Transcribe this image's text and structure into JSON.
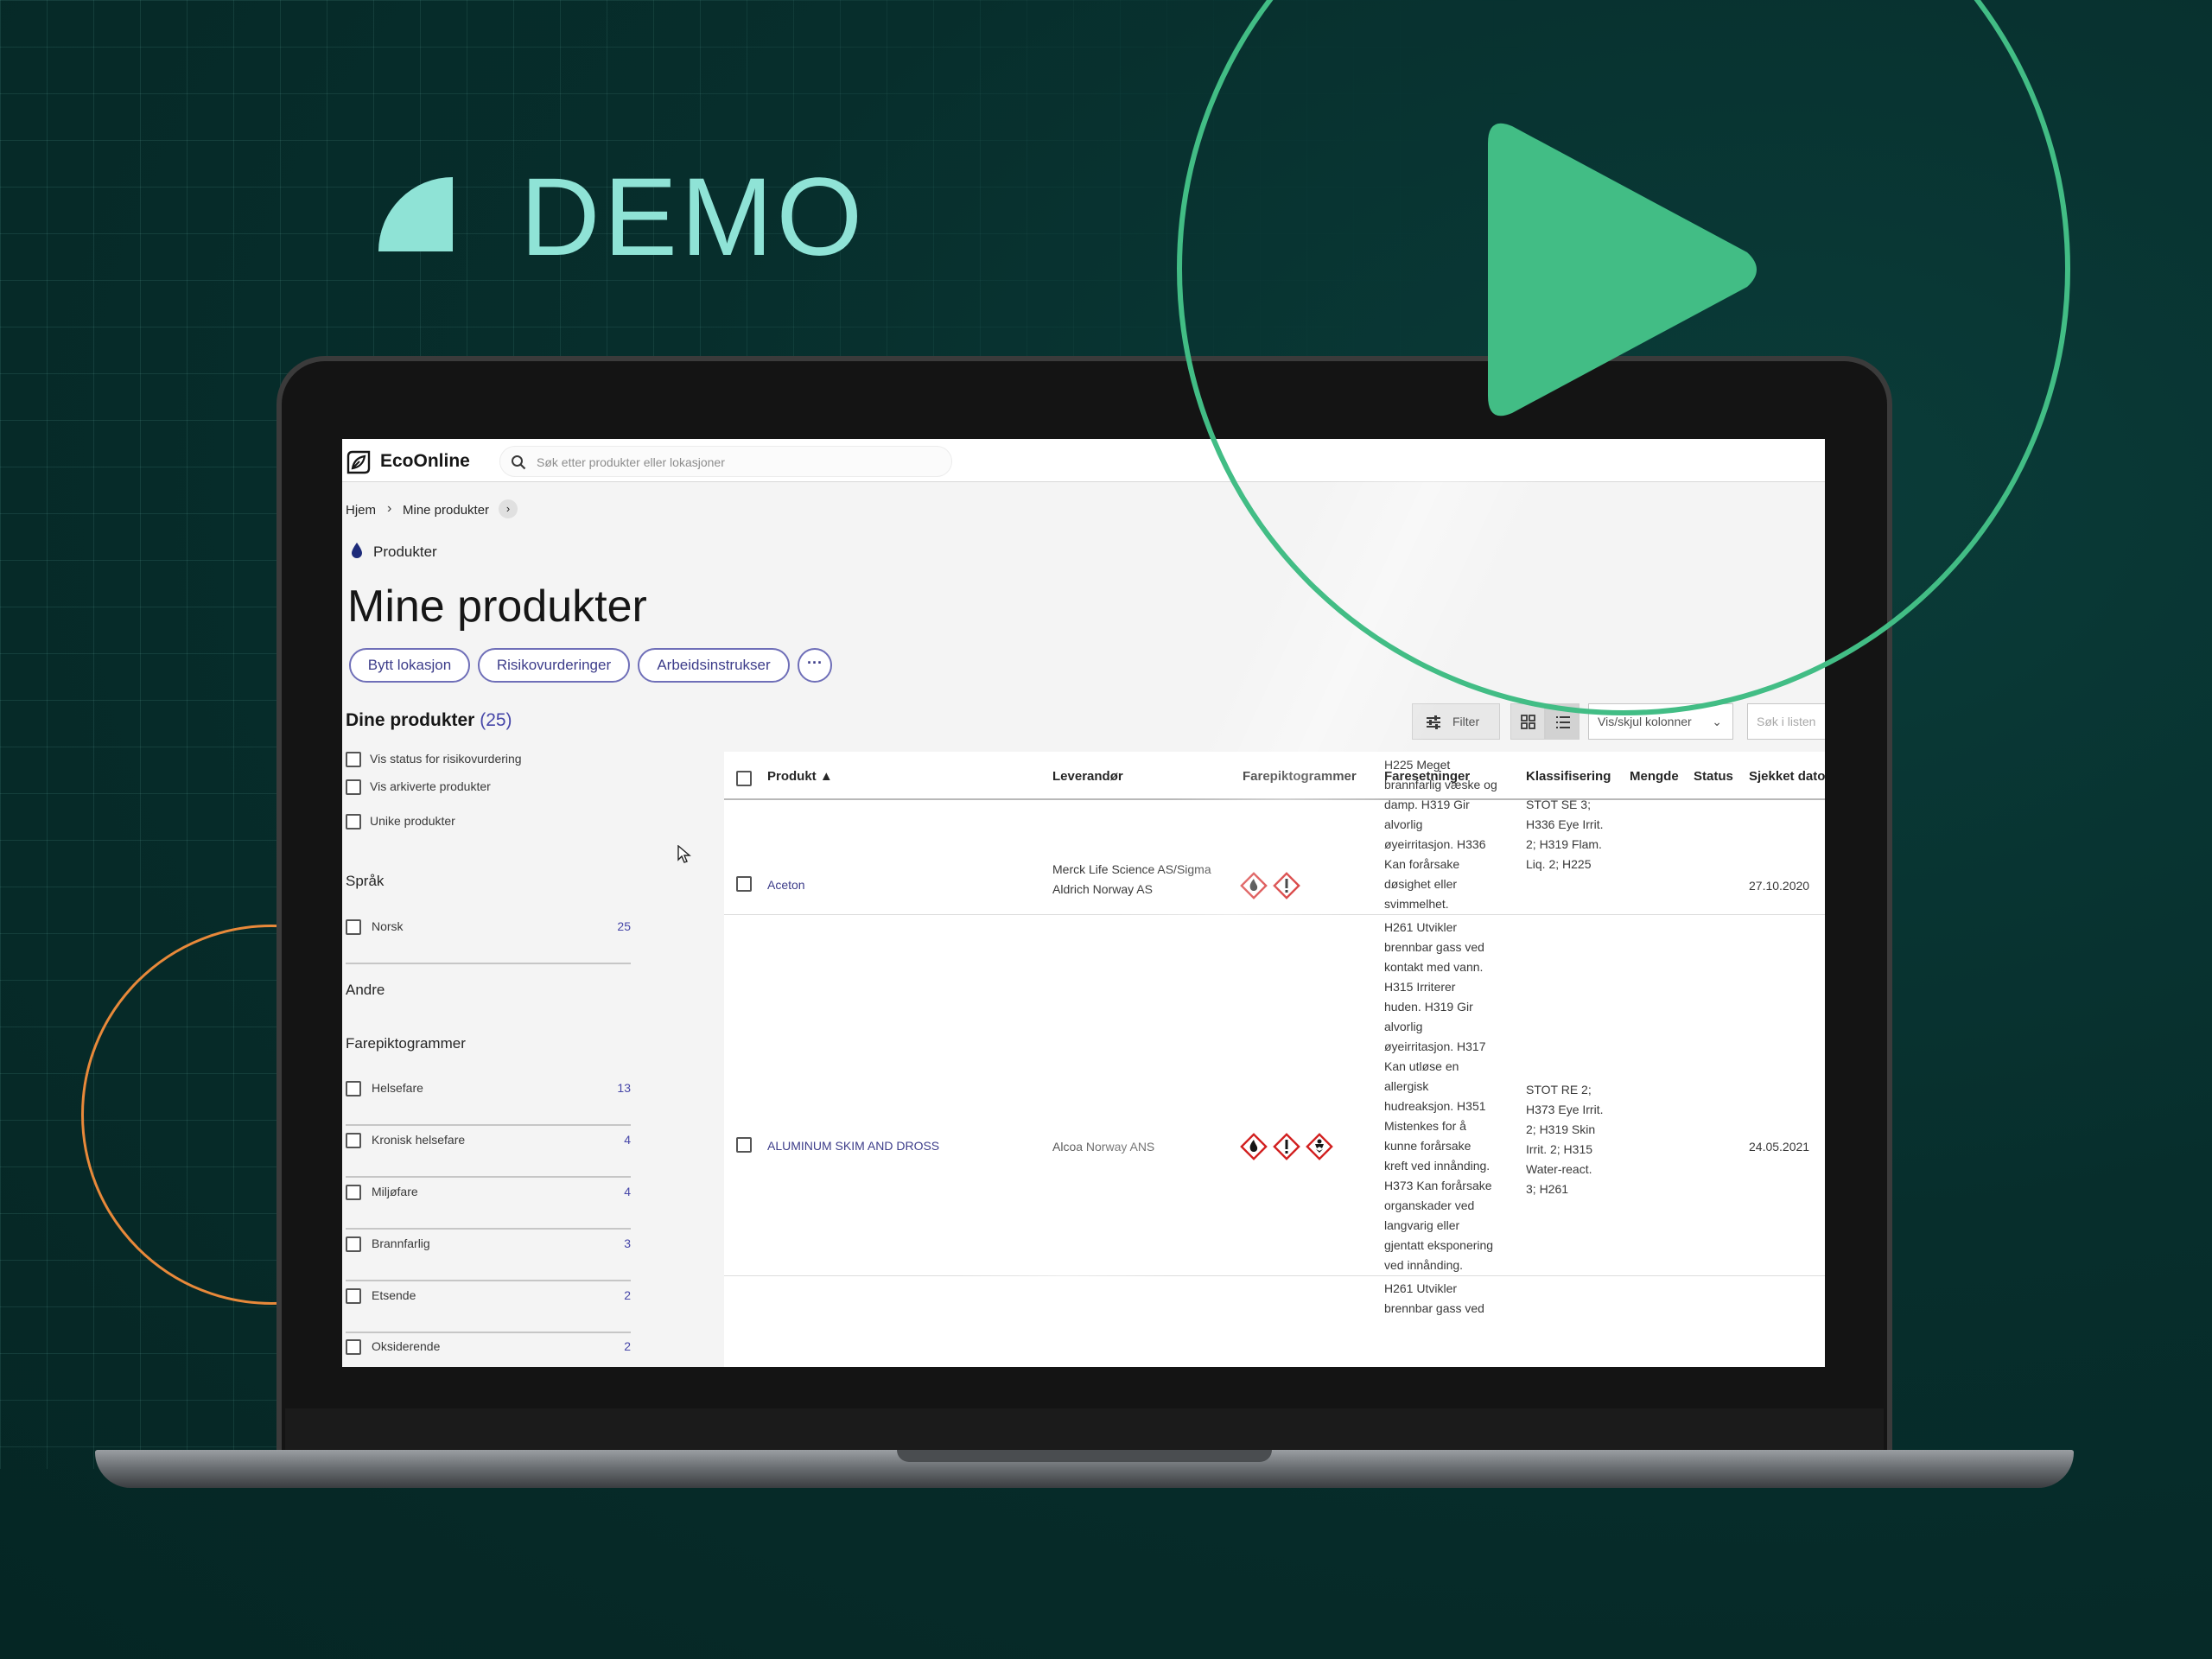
{
  "banner": {
    "label": "DEMO"
  },
  "app": {
    "brand": "EcoOnline",
    "search_placeholder": "Søk etter produkter eller lokasjoner"
  },
  "breadcrumb": {
    "home": "Hjem",
    "current": "Mine produkter"
  },
  "section": {
    "label": "Produkter"
  },
  "page": {
    "title": "Mine produkter"
  },
  "actions": {
    "switch_location": "Bytt lokasjon",
    "risk_assessments": "Risikovurderinger",
    "work_instructions": "Arbeidsinstrukser",
    "more": "···"
  },
  "sidebar": {
    "heading": "Dine produkter",
    "count": "(25)",
    "options": [
      "Vis status for risikovurdering",
      "Vis arkiverte produkter",
      "Unike produkter"
    ],
    "language_title": "Språk",
    "languages": [
      {
        "label": "Norsk",
        "count": "25"
      }
    ],
    "other_title": "Andre",
    "pictogram_title": "Farepiktogrammer",
    "pictograms": [
      {
        "label": "Helsefare",
        "count": "13"
      },
      {
        "label": "Kronisk helsefare",
        "count": "4"
      },
      {
        "label": "Miljøfare",
        "count": "4"
      },
      {
        "label": "Brannfarlig",
        "count": "3"
      },
      {
        "label": "Etsende",
        "count": "2"
      },
      {
        "label": "Oksiderende",
        "count": "2"
      }
    ]
  },
  "toolbar": {
    "filter": "Filter",
    "columns": "Vis/skjul kolonner",
    "search_placeholder": "Søk i listen"
  },
  "table": {
    "columns": {
      "product": "Produkt ▲",
      "supplier": "Leverandør",
      "pictograms": "Farepiktogrammer",
      "hazards": "Faresetninger",
      "classification": "Klassifisering",
      "amount": "Mengde",
      "status": "Status",
      "checked": "Sjekket dato"
    },
    "rows": [
      {
        "product": "Aceton",
        "supplier": [
          "Merck Life Science AS/Sigma",
          "Aldrich Norway AS"
        ],
        "hazards": [
          "H225 Meget",
          "brannfarlig væske og",
          "damp. H319 Gir",
          "alvorlig",
          "øyeirritasjon. H336",
          "Kan forårsake",
          "døsighet eller",
          "svimmelhet."
        ],
        "classification": [
          "STOT SE 3;",
          "H336 Eye Irrit.",
          "2; H319 Flam.",
          "Liq. 2; H225"
        ],
        "checked": "27.10.2020"
      },
      {
        "product": "ALUMINUM SKIM AND DROSS",
        "supplier": [
          "Alcoa Norway ANS"
        ],
        "hazards": [
          "H261 Utvikler",
          "brennbar gass ved",
          "kontakt med vann.",
          "H315 Irriterer",
          "huden. H319 Gir",
          "alvorlig",
          "øyeirritasjon. H317",
          "Kan utløse en",
          "allergisk",
          "hudreaksjon. H351",
          "Mistenkes for å",
          "kunne forårsake",
          "kreft ved innånding.",
          "H373 Kan forårsake",
          "organskader ved",
          "langvarig eller",
          "gjentatt eksponering",
          "ved innånding."
        ],
        "classification": [
          "STOT RE 2;",
          "H373 Eye Irrit.",
          "2; H319 Skin",
          "Irrit. 2; H315",
          "Water-react.",
          "3; H261"
        ],
        "checked": "24.05.2021"
      },
      {
        "hazards": [
          "H261 Utvikler",
          "brennbar gass ved"
        ]
      }
    ]
  },
  "colors": {
    "background": "#072e2c",
    "accent_teal": "#8fe3d6",
    "play_green": "#42bd85",
    "ring_orange": "#e8893a",
    "link_purple": "#3d3d8a",
    "hazard_red": "#d21f1f"
  }
}
